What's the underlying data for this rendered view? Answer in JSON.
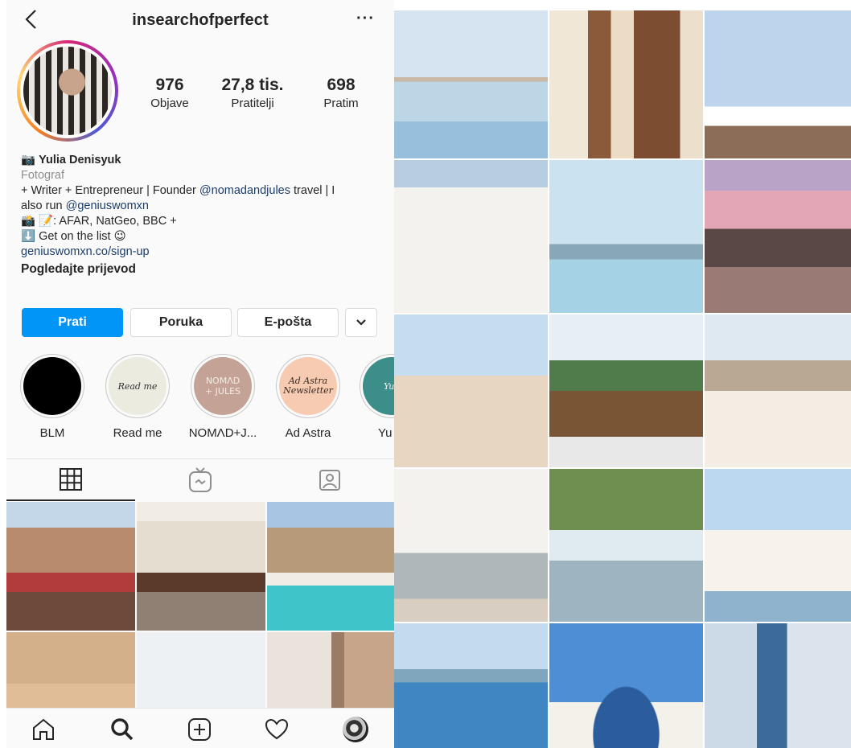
{
  "header": {
    "username": "insearchofperfect",
    "back_icon": "chevron-left-icon",
    "more_icon": "more-horizontal-icon",
    "more_glyph": "···"
  },
  "stats": [
    {
      "value": "976",
      "label": "Objave"
    },
    {
      "value": "27,8 tis.",
      "label": "Pratitelji"
    },
    {
      "value": "698",
      "label": "Pratim"
    }
  ],
  "bio": {
    "name": "Yulia Denisyuk",
    "name_icon": "📷",
    "category": "Fotograf",
    "line1_pre": "+ Writer + Entrepreneur | Founder ",
    "line1_mention": "@nomadandjules",
    "line1_post": " travel | I",
    "line2_pre": "also run ",
    "line2_mention": "@geniuswomxn",
    "line3": "📸 📝: AFAR, NatGeo, BBC +",
    "line4": "⬇️ Get on the list 😉",
    "website": "geniuswomxn.co/sign-up",
    "translate": "Pogledajte prijevod"
  },
  "buttons": {
    "follow": "Prati",
    "message": "Poruka",
    "email": "E-pošta",
    "dropdown_icon": "chevron-down-icon"
  },
  "highlights": [
    {
      "label": "BLM",
      "cover_text": ""
    },
    {
      "label": "Read me",
      "cover_text": "Read me"
    },
    {
      "label": "NOMΛD+J...",
      "cover_text": "NOMΛD + JULES"
    },
    {
      "label": "Ad Astra",
      "cover_text": "Ad Astra Newsletter"
    },
    {
      "label": "Yu",
      "cover_text": "Yu"
    }
  ],
  "tabs": [
    "grid-icon",
    "igtv-icon",
    "tagged-icon"
  ],
  "bottom_nav": [
    "home-icon",
    "search-icon",
    "add-post-icon",
    "activity-heart-icon",
    "profile-avatar-icon"
  ],
  "colors": {
    "accent": "#0095f6",
    "link": "#1b3d6b",
    "secondary_text": "#8e8e8e"
  }
}
